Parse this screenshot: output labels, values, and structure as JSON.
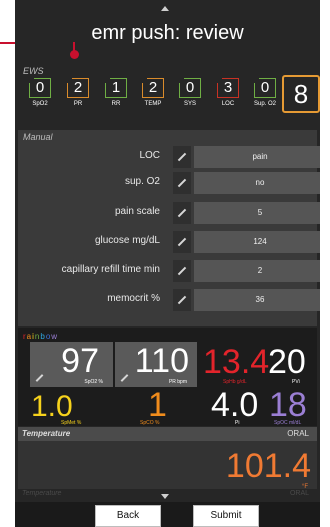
{
  "title": "emr push: review",
  "ews": {
    "label": "EWS",
    "total": "8",
    "items": [
      {
        "value": "0",
        "label": "SpO2",
        "level": "green"
      },
      {
        "value": "2",
        "label": "PR",
        "level": "orange"
      },
      {
        "value": "1",
        "label": "RR",
        "level": "green"
      },
      {
        "value": "2",
        "label": "TEMP",
        "level": "orange"
      },
      {
        "value": "0",
        "label": "SYS",
        "level": "green"
      },
      {
        "value": "3",
        "label": "LOC",
        "level": "red"
      },
      {
        "value": "0",
        "label": "Sup. O2",
        "level": "green"
      }
    ]
  },
  "manual": {
    "label": "Manual",
    "rows": [
      {
        "label": "LOC",
        "value": "pain"
      },
      {
        "label": "sup. O2",
        "value": "no"
      },
      {
        "label": "pain scale",
        "value": "5"
      },
      {
        "label": "glucose mg/dL",
        "value": "124"
      },
      {
        "label": "capillary refill time  min",
        "value": "2"
      },
      {
        "label": "memocrit %",
        "value": "36"
      }
    ]
  },
  "rainbow": {
    "label": "rainbow",
    "metrics": [
      {
        "value": "97",
        "label": "SpO2 %"
      },
      {
        "value": "110",
        "label": "PR bpm"
      },
      {
        "value": "13.4",
        "label": "SpHb g/dL"
      },
      {
        "value": "20",
        "label": "PVi"
      },
      {
        "value": "1.0",
        "label": "SpMet %"
      },
      {
        "value": "1",
        "label": "SpCO %"
      },
      {
        "value": "4.0",
        "label": "Pi"
      },
      {
        "value": "18",
        "label": "SpOC ml/dL"
      }
    ]
  },
  "temperature": {
    "label": "Temperature",
    "site": "ORAL",
    "value": "101.4",
    "unit": "°F"
  },
  "footer": {
    "faint_label": "Temperature",
    "faint_site": "ORAL",
    "back": "Back",
    "submit": "Submit"
  },
  "colors": {
    "green": "#6fae44",
    "orange": "#d98b2b",
    "red": "#c83224",
    "spmet": "#f6d21c",
    "sphb": "#e3242b",
    "spco": "#f08c1c",
    "spoc": "#9b7fd4",
    "temp": "#f07a33"
  }
}
